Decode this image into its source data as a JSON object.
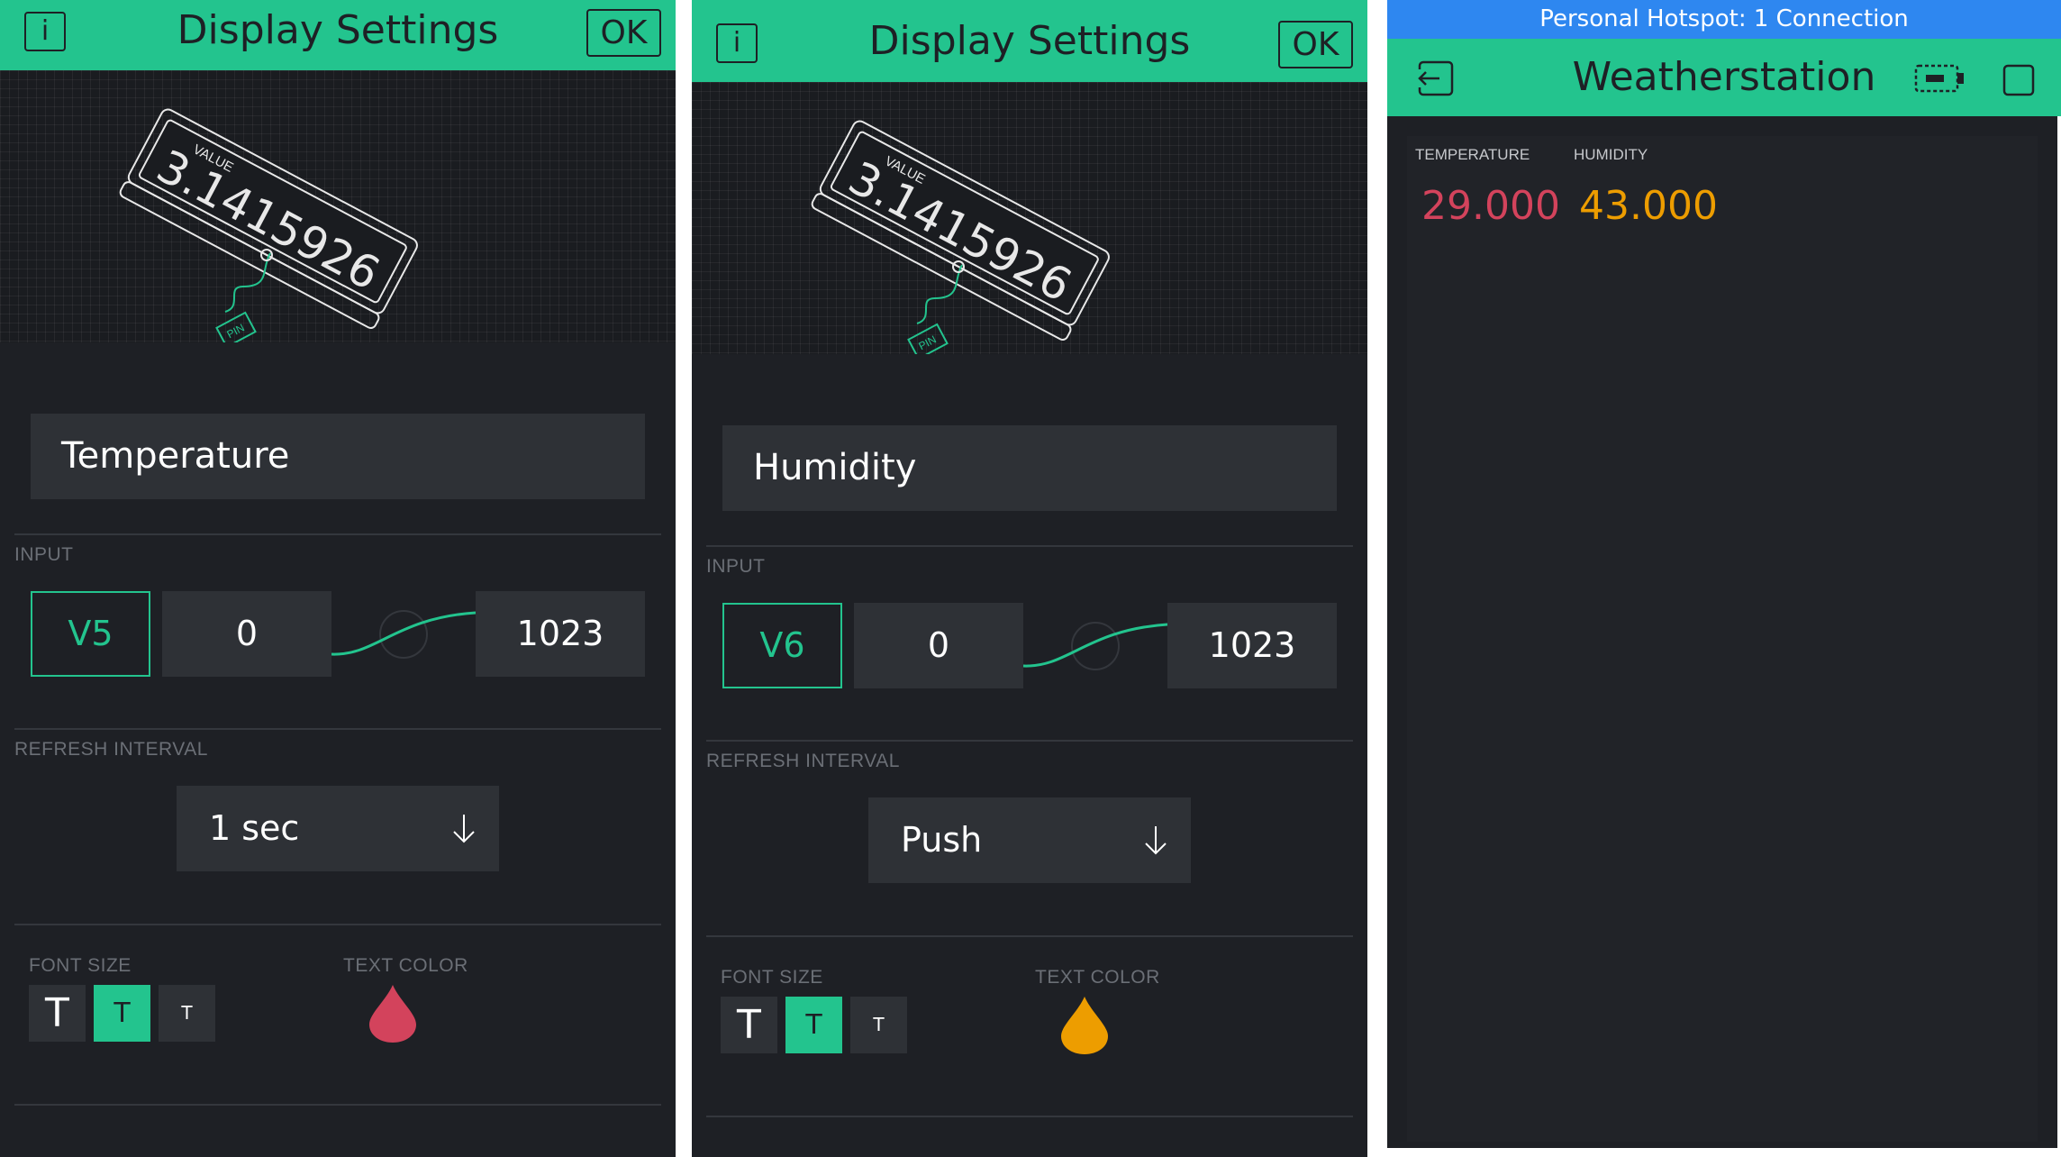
{
  "panels": [
    {
      "title": "Display Settings",
      "info_label": "i",
      "ok_label": "OK",
      "preview": {
        "value_label": "VALUE",
        "sample_value": "3.1415926",
        "pin_label": "PIN"
      },
      "name": "Temperature",
      "input_label": "INPUT",
      "pin": "V5",
      "min": "0",
      "max": "1023",
      "refresh_label": "REFRESH INTERVAL",
      "refresh_value": "1 sec",
      "font_size_label": "FONT SIZE",
      "font_sizes": [
        "T",
        "T",
        "T"
      ],
      "font_size_selected": 1,
      "text_color_label": "TEXT COLOR",
      "text_color": "#d3435c"
    },
    {
      "title": "Display Settings",
      "info_label": "i",
      "ok_label": "OK",
      "preview": {
        "value_label": "VALUE",
        "sample_value": "3.1415926",
        "pin_label": "PIN"
      },
      "name": "Humidity",
      "input_label": "INPUT",
      "pin": "V6",
      "min": "0",
      "max": "1023",
      "refresh_label": "REFRESH INTERVAL",
      "refresh_value": "Push",
      "font_size_label": "FONT SIZE",
      "font_sizes": [
        "T",
        "T",
        "T"
      ],
      "font_size_selected": 1,
      "text_color_label": "TEXT COLOR",
      "text_color": "#ed9d00"
    }
  ],
  "dashboard": {
    "status_bar": "Personal Hotspot: 1 Connection",
    "title": "Weatherstation",
    "widgets": [
      {
        "label": "TEMPERATURE",
        "value": "29.000",
        "color": "#d3435c"
      },
      {
        "label": "HUMIDITY",
        "value": "43.000",
        "color": "#ed9d00"
      }
    ]
  },
  "colors": {
    "accent": "#23c48e",
    "background": "#1e2025",
    "field": "#2e3136",
    "status_bar": "#2e87f0"
  }
}
